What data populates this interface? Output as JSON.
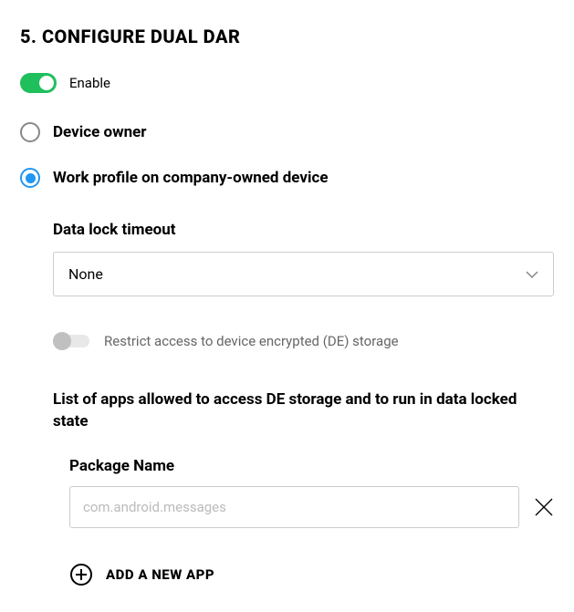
{
  "section": {
    "number": "5.",
    "title": "CONFIGURE DUAL DAR"
  },
  "enable": {
    "label": "Enable",
    "value": true
  },
  "modes": {
    "device_owner": {
      "label": "Device owner",
      "selected": false
    },
    "work_profile": {
      "label": "Work profile on company-owned device",
      "selected": true
    }
  },
  "data_lock": {
    "label": "Data lock timeout",
    "value": "None"
  },
  "restrict": {
    "label": "Restrict access to device encrypted (DE) storage",
    "value": false
  },
  "app_list": {
    "heading": "List of apps allowed to access DE storage and to run in data locked state",
    "package_label": "Package Name",
    "placeholder": "com.android.messages",
    "add_label": "ADD A NEW APP"
  }
}
